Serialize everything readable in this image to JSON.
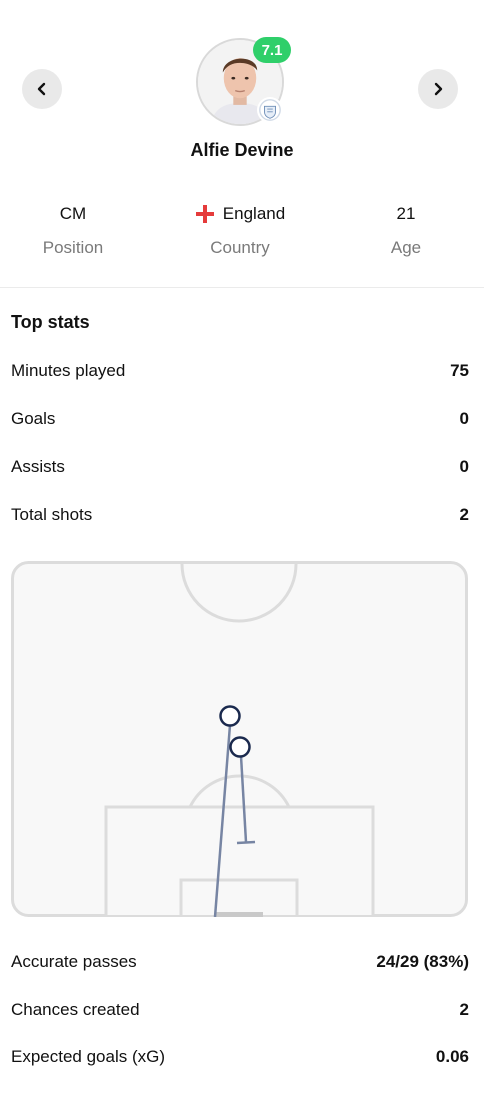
{
  "player": {
    "name": "Alfie Devine",
    "rating": "7.1",
    "position_value": "CM",
    "position_label": "Position",
    "country_value": "England",
    "country_label": "Country",
    "age_value": "21",
    "age_label": "Age"
  },
  "top_stats": {
    "title": "Top stats",
    "rows": [
      {
        "label": "Minutes played",
        "value": "75"
      },
      {
        "label": "Goals",
        "value": "0"
      },
      {
        "label": "Assists",
        "value": "0"
      },
      {
        "label": "Total shots",
        "value": "2"
      }
    ]
  },
  "more_stats": {
    "rows": [
      {
        "label": "Accurate passes",
        "value": "24/29 (83%)"
      },
      {
        "label": "Chances created",
        "value": "2"
      },
      {
        "label": "Expected goals (xG)",
        "value": "0.06"
      }
    ]
  },
  "icons": {
    "prev": "chevron-left-icon",
    "next": "chevron-right-icon",
    "flag": "england-flag-icon",
    "crest": "team-crest-icon"
  },
  "colors": {
    "rating_badge": "#2fcf6a",
    "shot_marker": "#1b2a4e",
    "pitch_lines": "#dcdcdc",
    "pitch_bg": "#f8f8f8"
  }
}
